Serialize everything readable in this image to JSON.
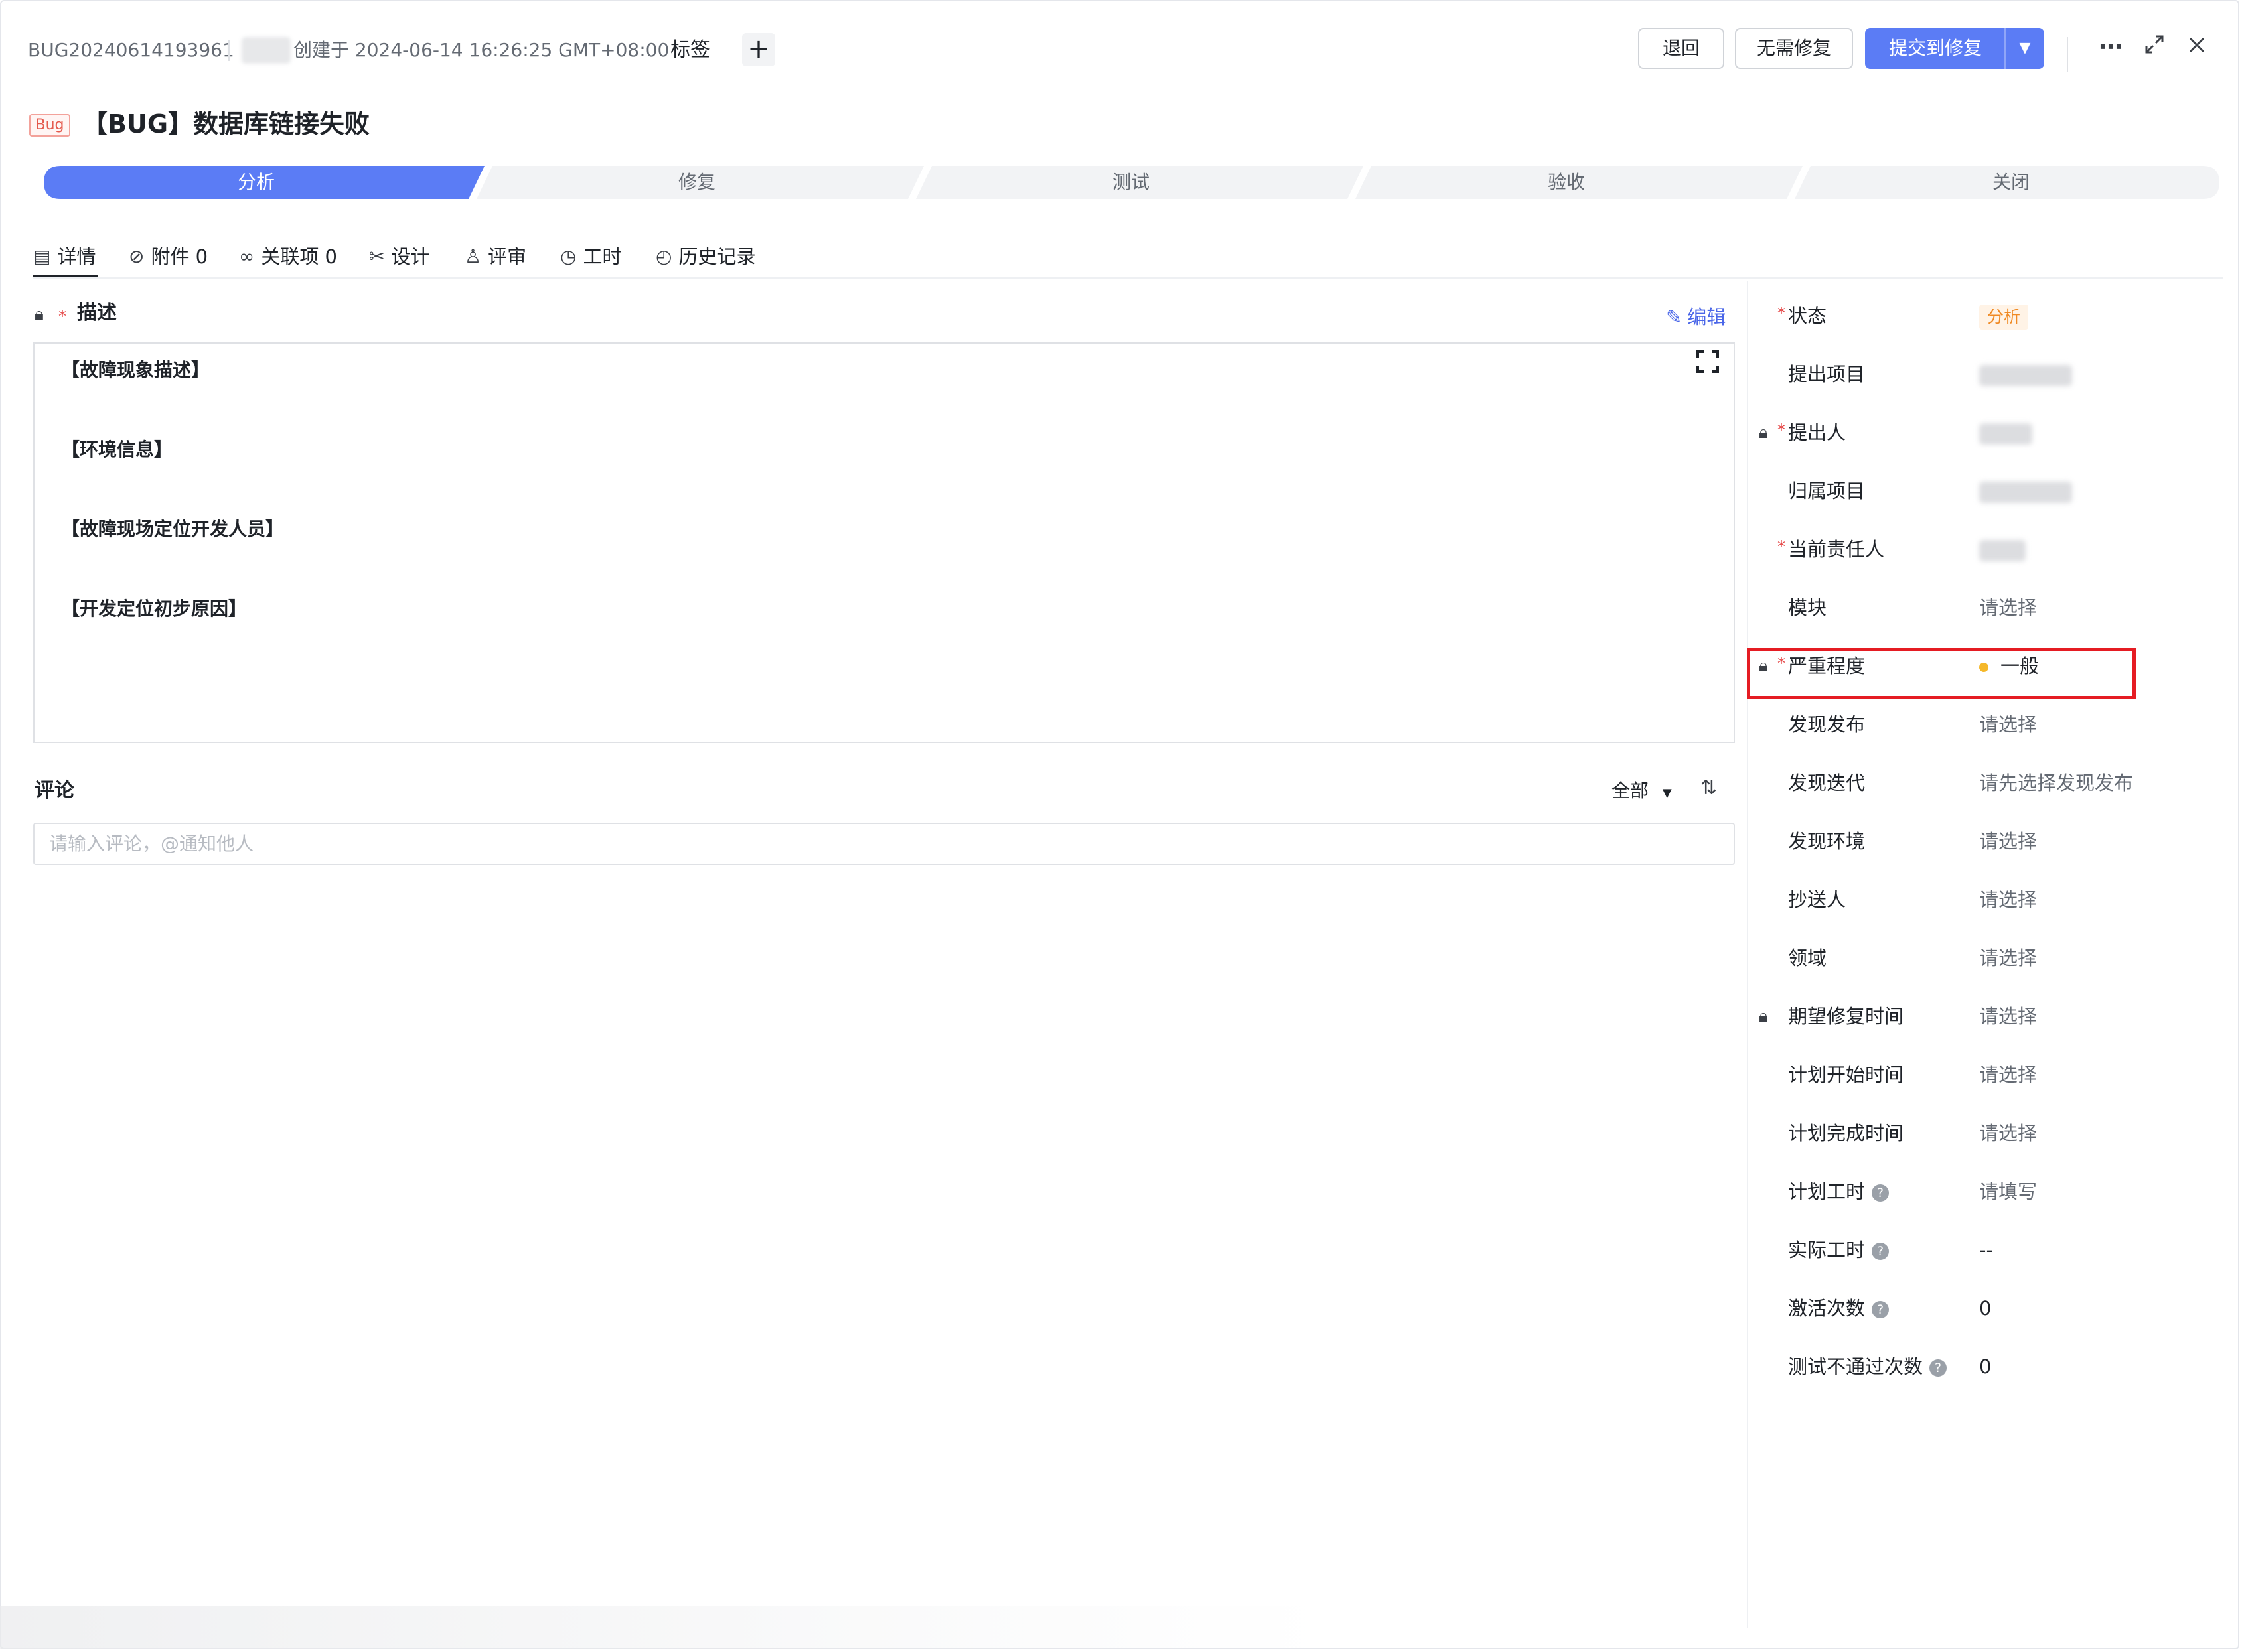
{
  "header": {
    "bug_id": "BUG20240614193961",
    "created_text": "创建于 2024-06-14 16:26:25 GMT+08:00",
    "tag_label": "标签",
    "add_tag_symbol": "+",
    "buttons": {
      "back": "退回",
      "no_fix": "无需修复",
      "submit_fix": "提交到修复"
    },
    "icons": [
      "more-icon",
      "expand-icon",
      "close-icon"
    ]
  },
  "title": {
    "badge": "Bug",
    "text": "【BUG】数据库链接失败"
  },
  "workflow": {
    "stages": [
      "分析",
      "修复",
      "测试",
      "验收",
      "关闭"
    ],
    "active_index": 0,
    "active_color": "#5b7cf5"
  },
  "tabs": [
    {
      "label": "详情",
      "icon": "details-icon"
    },
    {
      "label": "附件 0",
      "icon": "attachment-icon"
    },
    {
      "label": "关联项 0",
      "icon": "link-icon"
    },
    {
      "label": "设计",
      "icon": "design-icon"
    },
    {
      "label": "评审",
      "icon": "review-icon"
    },
    {
      "label": "工时",
      "icon": "clock-icon"
    },
    {
      "label": "历史记录",
      "icon": "history-icon"
    }
  ],
  "description": {
    "title": "描述",
    "edit_label": "编辑",
    "lines": [
      "【故障现象描述】",
      "【环境信息】",
      "【故障现场定位开发人员】",
      "【开发定位初步原因】"
    ]
  },
  "comments": {
    "title": "评论",
    "filter": "全部",
    "placeholder": "请输入评论，@通知他人"
  },
  "properties": [
    {
      "label": "状态",
      "value": "分析",
      "type": "status"
    },
    {
      "label": "提出项目",
      "value": "",
      "type": "blurred"
    },
    {
      "label": "提出人",
      "value": "",
      "type": "blurred"
    },
    {
      "label": "归属项目",
      "value": "",
      "type": "blurred"
    },
    {
      "label": "当前责任人",
      "value": "",
      "type": "blurred"
    },
    {
      "label": "模块",
      "value": "请选择",
      "type": "placeholder"
    },
    {
      "label": "严重程度",
      "value": "一般",
      "type": "severity"
    },
    {
      "label": "发现发布",
      "value": "请选择",
      "type": "placeholder"
    },
    {
      "label": "发现迭代",
      "value": "请先选择发现发布",
      "type": "placeholder"
    },
    {
      "label": "发现环境",
      "value": "请选择",
      "type": "placeholder"
    },
    {
      "label": "抄送人",
      "value": "请选择",
      "type": "placeholder"
    },
    {
      "label": "领域",
      "value": "请选择",
      "type": "placeholder"
    },
    {
      "label": "期望修复时间",
      "value": "请选择",
      "type": "placeholder"
    },
    {
      "label": "计划开始时间",
      "value": "请选择",
      "type": "placeholder"
    },
    {
      "label": "计划完成时间",
      "value": "请选择",
      "type": "placeholder"
    },
    {
      "label": "计划工时",
      "value": "请填写",
      "type": "placeholder"
    },
    {
      "label": "实际工时",
      "value": "--",
      "type": "text"
    },
    {
      "label": "激活次数",
      "value": "0",
      "type": "text"
    },
    {
      "label": "测试不通过次数",
      "value": "0",
      "type": "text"
    }
  ],
  "colors": {
    "primary": "#5b7cf5",
    "status_orange": "#f08a24",
    "severity_dot": "#f5b82a",
    "highlight": "#e51c23",
    "required_star": "#e54545"
  }
}
